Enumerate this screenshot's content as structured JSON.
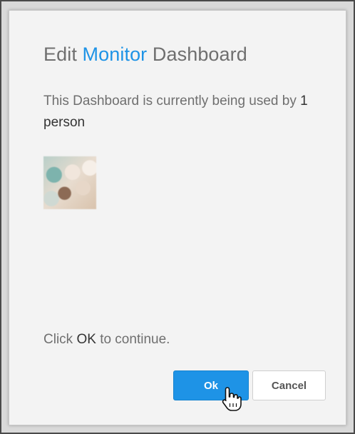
{
  "dialog": {
    "title_prefix": "Edit",
    "title_accent": "Monitor",
    "title_suffix": "Dashboard",
    "message_line": "This Dashboard is currently being used by",
    "message_count": "1 person",
    "footer_prefix": "Click",
    "footer_keyword": "OK",
    "footer_suffix": "to continue.",
    "ok_label": "Ok",
    "cancel_label": "Cancel"
  },
  "colors": {
    "accent": "#1e93e6",
    "text": "#6f6f6f",
    "text_strong": "#333333",
    "background": "#f3f3f3"
  },
  "icons": {
    "cursor": "hand-pointer-icon",
    "user": "user-avatar"
  }
}
